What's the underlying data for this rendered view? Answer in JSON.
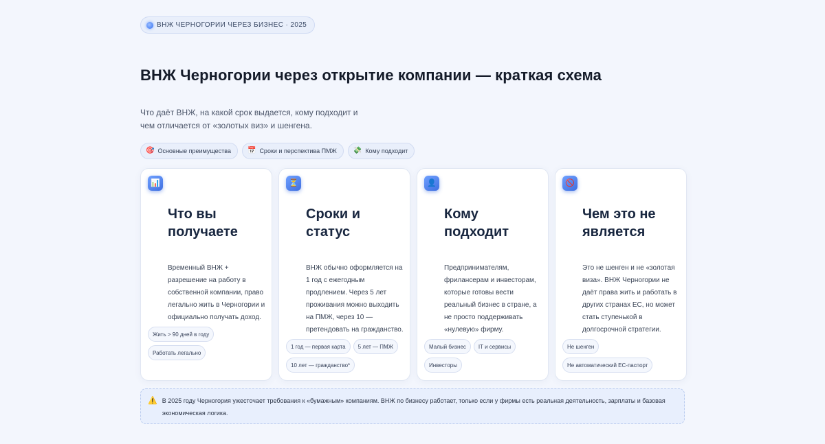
{
  "badge": {
    "label": "ВНЖ ЧЕРНОГОРИИ ЧЕРЕЗ БИЗНЕС · 2025"
  },
  "header": {
    "title": "ВНЖ Черногории через открытие компании — краткая схема",
    "subtitle": "Что даёт ВНЖ, на какой срок выдается, кому подходит и чем отличается от «золотых виз» и шенгена."
  },
  "chips": [
    {
      "icon": "🎯",
      "label": "Основные преимущества"
    },
    {
      "icon": "📅",
      "label": "Сроки и перспектива ПМЖ"
    },
    {
      "icon": "💸",
      "label": "Кому подходит"
    }
  ],
  "cards": [
    {
      "icon": "📊",
      "title": "Что вы получаете",
      "text": "Временный ВНЖ + разрешение на работу в собственной компании, право легально жить в Черногории и официально получать доход.",
      "tags": [
        "Жить > 90 дней в году",
        "Работать легально"
      ]
    },
    {
      "icon": "⏳",
      "title": "Сроки и статус",
      "text": "ВНЖ обычно оформляется на 1 год с ежегодным продлением. Через 5 лет проживания можно выходить на ПМЖ, через 10 — претендовать на гражданство.",
      "tags": [
        "1 год — первая карта",
        "5 лет — ПМЖ",
        "10 лет — гражданство*"
      ]
    },
    {
      "icon": "👤",
      "title": "Кому подходит",
      "text": "Предпринимателям, фрилансерам и инвесторам, которые готовы вести реальный бизнес в стране, а не просто поддерживать «нулевую» фирму.",
      "tags": [
        "Малый бизнес",
        "IT и сервисы",
        "Инвесторы"
      ]
    },
    {
      "icon": "🚫",
      "title": "Чем это не является",
      "text": "Это не шенген и не «золотая виза». ВНЖ Черногории не даёт права жить и работать в других странах ЕС, но может стать ступенькой в долгосрочной стратегии.",
      "tags": [
        "Не шенген",
        "Не автоматический ЕС-паспорт"
      ]
    }
  ],
  "notice": {
    "icon": "⚠️",
    "text": "В 2025 году Черногория ужесточает требования к «бумажным» компаниям. ВНЖ по бизнесу работает, только если у фирмы есть реальная деятельность, зарплаты и базовая экономическая логика."
  }
}
